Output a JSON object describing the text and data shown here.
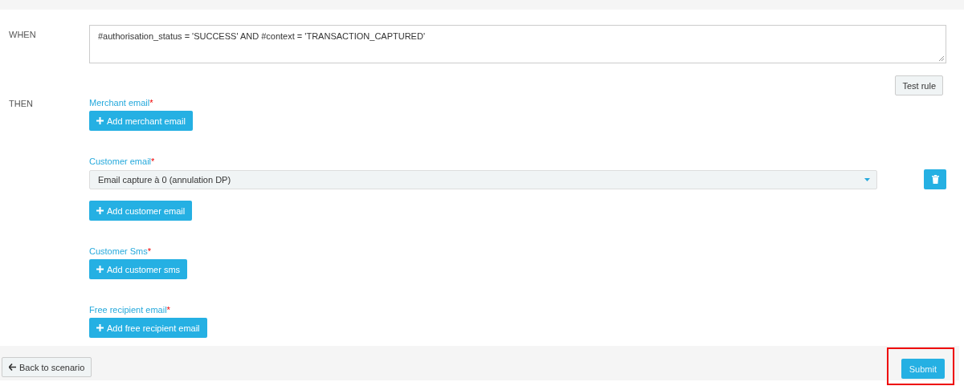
{
  "when": {
    "label": "WHEN",
    "value": "#authorisation_status = 'SUCCESS' AND #context = 'TRANSACTION_CAPTURED'"
  },
  "test_button": "Test rule",
  "then": {
    "label": "THEN",
    "groups": [
      {
        "label": "Merchant email",
        "required_mark": "*",
        "add_button": "Add merchant email"
      },
      {
        "label": "Customer email",
        "required_mark": "*",
        "selects": [
          "Email capture à 0 (annulation DP)"
        ],
        "add_button": "Add customer email"
      },
      {
        "label": "Customer Sms",
        "required_mark": "*",
        "add_button": "Add customer sms"
      },
      {
        "label": "Free recipient email",
        "required_mark": "*",
        "add_button": "Add free recipient email"
      }
    ]
  },
  "footer": {
    "back_button": "Back to scenario",
    "submit_button": {
      "label": "Submit",
      "highlighted": true
    }
  }
}
